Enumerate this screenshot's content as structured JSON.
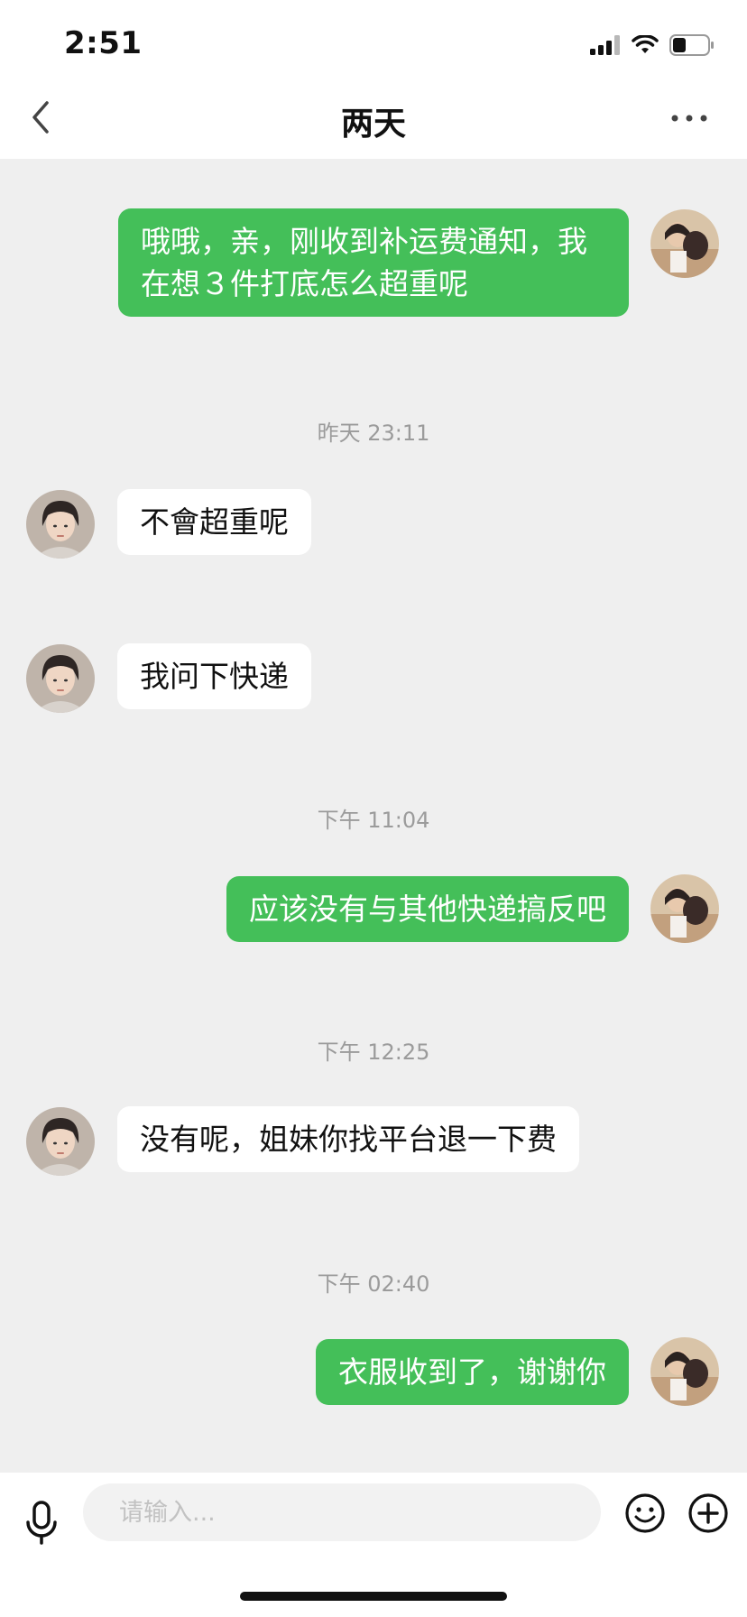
{
  "status_bar": {
    "time": "2:51"
  },
  "nav": {
    "title": "两天",
    "back_icon": "chevron-left-icon",
    "more_icon": "more-dots-icon"
  },
  "messages": [
    {
      "side": "mine",
      "text": "哦哦，亲，刚收到补运费通知，我在想３件打底怎么超重呢"
    },
    {
      "timestamp": "昨天 23:11"
    },
    {
      "side": "theirs",
      "text": "不會超重呢"
    },
    {
      "side": "theirs",
      "text": "我问下快递"
    },
    {
      "timestamp": "下午 11:04"
    },
    {
      "side": "mine",
      "text": "应该没有与其他快递搞反吧"
    },
    {
      "timestamp": "下午 12:25"
    },
    {
      "side": "theirs",
      "text": "没有呢，姐妹你找平台退一下费"
    },
    {
      "timestamp": "下午 02:40"
    },
    {
      "side": "mine",
      "text": "衣服收到了，谢谢你"
    }
  ],
  "input_bar": {
    "placeholder": "请输入...",
    "mic_icon": "microphone-icon",
    "emoji_icon": "emoji-icon",
    "plus_icon": "plus-circle-icon"
  },
  "colors": {
    "my_bubble": "#44bf59",
    "their_bubble": "#ffffff",
    "background": "#efefef"
  }
}
